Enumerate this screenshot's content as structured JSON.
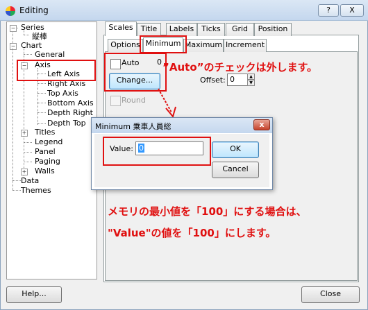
{
  "window": {
    "title": "Editing",
    "help_caption": "?",
    "close_caption": "X"
  },
  "tree": {
    "series": "Series",
    "series_child": "縦棒",
    "chart": "Chart",
    "general": "General",
    "axis": "Axis",
    "left_axis": "Left Axis",
    "right_axis": "Right Axis",
    "top_axis": "Top Axis",
    "bottom_axis": "Bottom Axis",
    "depth_right": "Depth Right",
    "depth_top": "Depth Top",
    "titles": "Titles",
    "legend": "Legend",
    "panel": "Panel",
    "paging": "Paging",
    "walls": "Walls",
    "data": "Data",
    "themes": "Themes"
  },
  "tabs": {
    "main": [
      "Scales",
      "Title",
      "Labels",
      "Ticks",
      "Grid",
      "Position"
    ],
    "sub": [
      "Options",
      "Minimum",
      "Maximum",
      "Increment"
    ]
  },
  "minimum_page": {
    "auto_label": "Auto",
    "auto_checked": false,
    "value_readout": "0",
    "change_button": "Change...",
    "offset_label": "Offset:",
    "offset_value": "0",
    "round_label": "Round"
  },
  "dialog": {
    "title": "Minimum 乗車人員総",
    "close": "x",
    "value_label": "Value:",
    "value": "0",
    "ok": "OK",
    "cancel": "Cancel"
  },
  "annotations": {
    "auto_note": "”Auto”のチェックは外します。",
    "value_note_line1": "メモリの最小値を「100」にする場合は、",
    "value_note_line2": "\"Value\"の値を「100」にします。",
    "color": "#e01010"
  },
  "footer": {
    "help": "Help...",
    "close": "Close"
  }
}
